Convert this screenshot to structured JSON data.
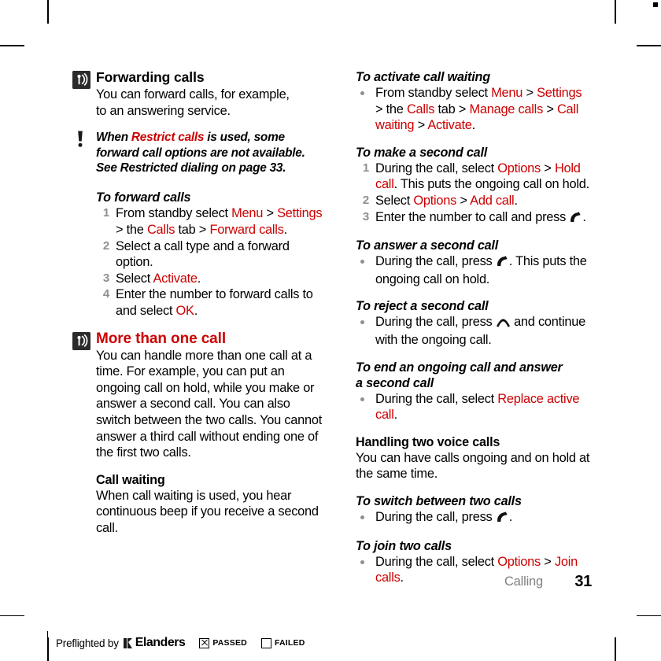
{
  "document": {
    "footer": {
      "section": "Calling",
      "page_number": "31"
    }
  },
  "left_column": {
    "forwarding": {
      "icon": "signal-waves-icon",
      "heading": "Forwarding calls",
      "body_line1": "You can forward calls, for example,",
      "body_line2": "to an answering service."
    },
    "tip": {
      "icon": "exclamation-icon",
      "text_1": "When ",
      "text_highlight": "Restrict calls",
      "text_2": " is used, some forward call options are not available.",
      "text_3": "See Restricted dialing on page 33."
    },
    "forward_calls": {
      "heading": "To forward calls",
      "steps": [
        {
          "num": "1",
          "parts": [
            {
              "t": "From standby select ",
              "c": "black"
            },
            {
              "t": "Menu",
              "c": "red"
            },
            {
              "t": " > ",
              "c": "black"
            },
            {
              "t": "Settings",
              "c": "red"
            },
            {
              "t": " > the ",
              "c": "black"
            },
            {
              "t": "Calls",
              "c": "red"
            },
            {
              "t": " tab > ",
              "c": "black"
            },
            {
              "t": "Forward calls",
              "c": "red"
            },
            {
              "t": ".",
              "c": "black"
            }
          ]
        },
        {
          "num": "2",
          "parts": [
            {
              "t": "Select a call type and a forward option.",
              "c": "black"
            }
          ]
        },
        {
          "num": "3",
          "parts": [
            {
              "t": "Select ",
              "c": "black"
            },
            {
              "t": "Activate",
              "c": "red"
            },
            {
              "t": ".",
              "c": "black"
            }
          ]
        },
        {
          "num": "4",
          "parts": [
            {
              "t": "Enter the number to forward calls to and select ",
              "c": "black"
            },
            {
              "t": "OK",
              "c": "red"
            },
            {
              "t": ".",
              "c": "black"
            }
          ]
        }
      ]
    },
    "more_than_one_call": {
      "icon": "signal-waves-icon",
      "heading": "More than one call",
      "body": "You can handle more than one call at a time. For example, you can put an ongoing call on hold, while you make or answer a second call. You can also switch between the two calls. You cannot answer a third call without ending one of the first two calls."
    },
    "call_waiting": {
      "heading": "Call waiting",
      "body": "When call waiting is used, you hear continuous beep if you receive a second call."
    }
  },
  "right_column": {
    "activate_call_waiting": {
      "heading": "To activate call waiting",
      "bullets": [
        {
          "parts": [
            {
              "t": "From standby select ",
              "c": "black"
            },
            {
              "t": "Menu",
              "c": "red"
            },
            {
              "t": " > ",
              "c": "black"
            },
            {
              "t": "Settings",
              "c": "red"
            },
            {
              "t": " > the ",
              "c": "black"
            },
            {
              "t": "Calls",
              "c": "red"
            },
            {
              "t": " tab > ",
              "c": "black"
            },
            {
              "t": "Manage calls",
              "c": "red"
            },
            {
              "t": " > ",
              "c": "black"
            },
            {
              "t": "Call waiting",
              "c": "red"
            },
            {
              "t": " > ",
              "c": "black"
            },
            {
              "t": "Activate",
              "c": "red"
            },
            {
              "t": ".",
              "c": "black"
            }
          ]
        }
      ]
    },
    "make_second_call": {
      "heading": "To make a second call",
      "steps": [
        {
          "num": "1",
          "parts": [
            {
              "t": "During the call, select ",
              "c": "black"
            },
            {
              "t": "Options",
              "c": "red"
            },
            {
              "t": " > ",
              "c": "black"
            },
            {
              "t": "Hold call",
              "c": "red"
            },
            {
              "t": ". This puts the ongoing call on hold.",
              "c": "black"
            }
          ]
        },
        {
          "num": "2",
          "parts": [
            {
              "t": "Select ",
              "c": "black"
            },
            {
              "t": "Options",
              "c": "red"
            },
            {
              "t": " > ",
              "c": "black"
            },
            {
              "t": "Add call",
              "c": "red"
            },
            {
              "t": ".",
              "c": "black"
            }
          ]
        },
        {
          "num": "3",
          "parts": [
            {
              "t": "Enter the number to call and press ",
              "c": "black"
            },
            {
              "t": "",
              "c": "glyph-call"
            },
            {
              "t": ".",
              "c": "black"
            }
          ]
        }
      ]
    },
    "answer_second_call": {
      "heading": "To answer a second call",
      "bullets": [
        {
          "parts": [
            {
              "t": "During the call, press ",
              "c": "black"
            },
            {
              "t": "",
              "c": "glyph-call"
            },
            {
              "t": ". This puts the ongoing call on hold.",
              "c": "black"
            }
          ]
        }
      ]
    },
    "reject_second_call": {
      "heading": "To reject a second call",
      "bullets": [
        {
          "parts": [
            {
              "t": "During the call, press ",
              "c": "black"
            },
            {
              "t": "",
              "c": "glyph-endcall"
            },
            {
              "t": " and continue with the ongoing call.",
              "c": "black"
            }
          ]
        }
      ]
    },
    "end_ongoing_answer_second": {
      "heading_line1": "To end an ongoing call and answer",
      "heading_line2": "a second call",
      "bullets": [
        {
          "parts": [
            {
              "t": "During the call, select ",
              "c": "black"
            },
            {
              "t": "Replace active call",
              "c": "red"
            },
            {
              "t": ".",
              "c": "black"
            }
          ]
        }
      ]
    },
    "handling_two_voice_calls": {
      "heading": "Handling two voice calls",
      "body": "You can have calls ongoing and on hold at the same time."
    },
    "switch_between_calls": {
      "heading": "To switch between two calls",
      "bullets": [
        {
          "parts": [
            {
              "t": "During the call, press ",
              "c": "black"
            },
            {
              "t": "",
              "c": "glyph-call"
            },
            {
              "t": ".",
              "c": "black"
            }
          ]
        }
      ]
    },
    "join_two_calls": {
      "heading": "To join two calls",
      "bullets": [
        {
          "parts": [
            {
              "t": "During the call, select ",
              "c": "black"
            },
            {
              "t": "Options",
              "c": "red"
            },
            {
              "t": " > ",
              "c": "black"
            },
            {
              "t": "Join calls",
              "c": "red"
            },
            {
              "t": ".",
              "c": "black"
            }
          ]
        }
      ]
    }
  },
  "preflight": {
    "text": "Preflighted by",
    "brand": "Elanders",
    "passed_label": "PASSED",
    "failed_label": "FAILED",
    "passed_checked": true,
    "failed_checked": false
  },
  "colors": {
    "accent_red": "#cc0000",
    "muted_gray": "#8f8f8f",
    "footer_gray": "#808080",
    "icon_dark": "#2b2b2b"
  }
}
